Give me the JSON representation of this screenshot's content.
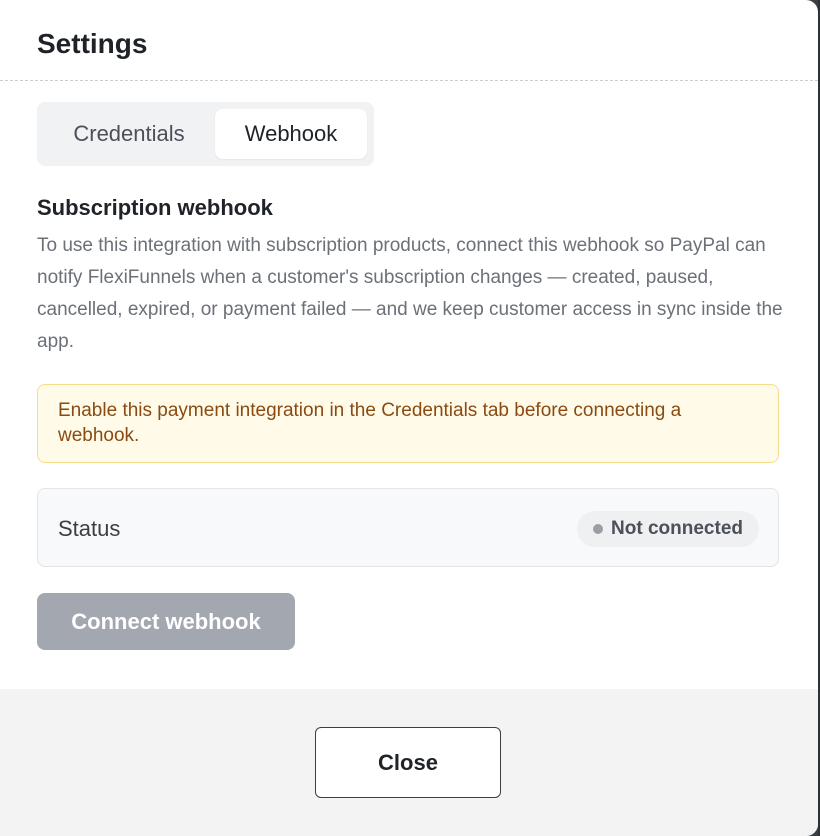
{
  "dialog": {
    "title": "Settings"
  },
  "tabs": [
    {
      "label": "Credentials",
      "active": false
    },
    {
      "label": "Webhook",
      "active": true
    }
  ],
  "webhook": {
    "title": "Subscription webhook",
    "description": "To use this integration with subscription products, connect this webhook so PayPal can notify FlexiFunnels when a customer's subscription changes — created, paused, cancelled, expired, or payment failed — and we keep customer access in sync inside the app.",
    "alert": "Enable this payment integration in the Credentials tab before connecting a webhook.",
    "status_label": "Status",
    "status_value": "Not connected",
    "connect_label": "Connect webhook",
    "connect_disabled": true
  },
  "footer": {
    "close_label": "Close"
  },
  "colors": {
    "alert_background": "#fffbe8",
    "alert_text": "#8a4a12",
    "disabled_button": "#a2a7b0",
    "status_dot": "#9a9ea5"
  }
}
